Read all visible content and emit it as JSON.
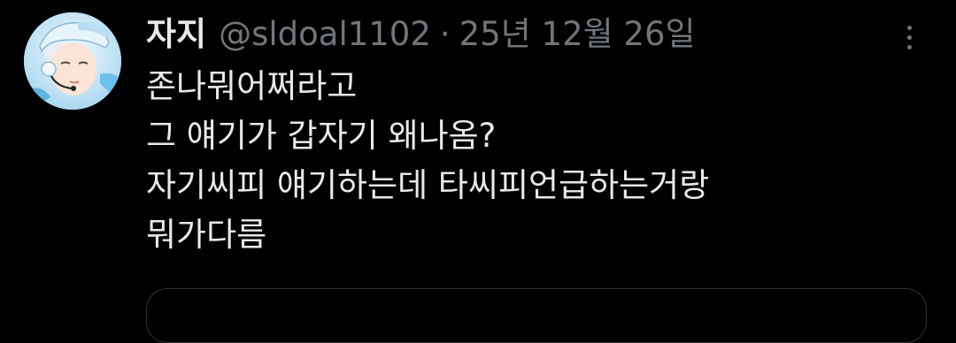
{
  "tweet": {
    "display_name": "자지",
    "handle": "@sldoal1102",
    "separator": "·",
    "timestamp": "25년 12월 26일",
    "lines": [
      "존나뭐어쩌라고",
      "그 얘기가 갑자기 왜나옴?",
      "자기씨피 얘기하는데 타씨피언급하는거랑",
      "뭐가다름"
    ]
  },
  "icons": {
    "avatar": "profile-avatar",
    "more": "more-options-icon"
  },
  "colors": {
    "background": "#000000",
    "primary_text": "#e7e9ea",
    "secondary_text": "#71767b",
    "border": "#2f3336"
  }
}
